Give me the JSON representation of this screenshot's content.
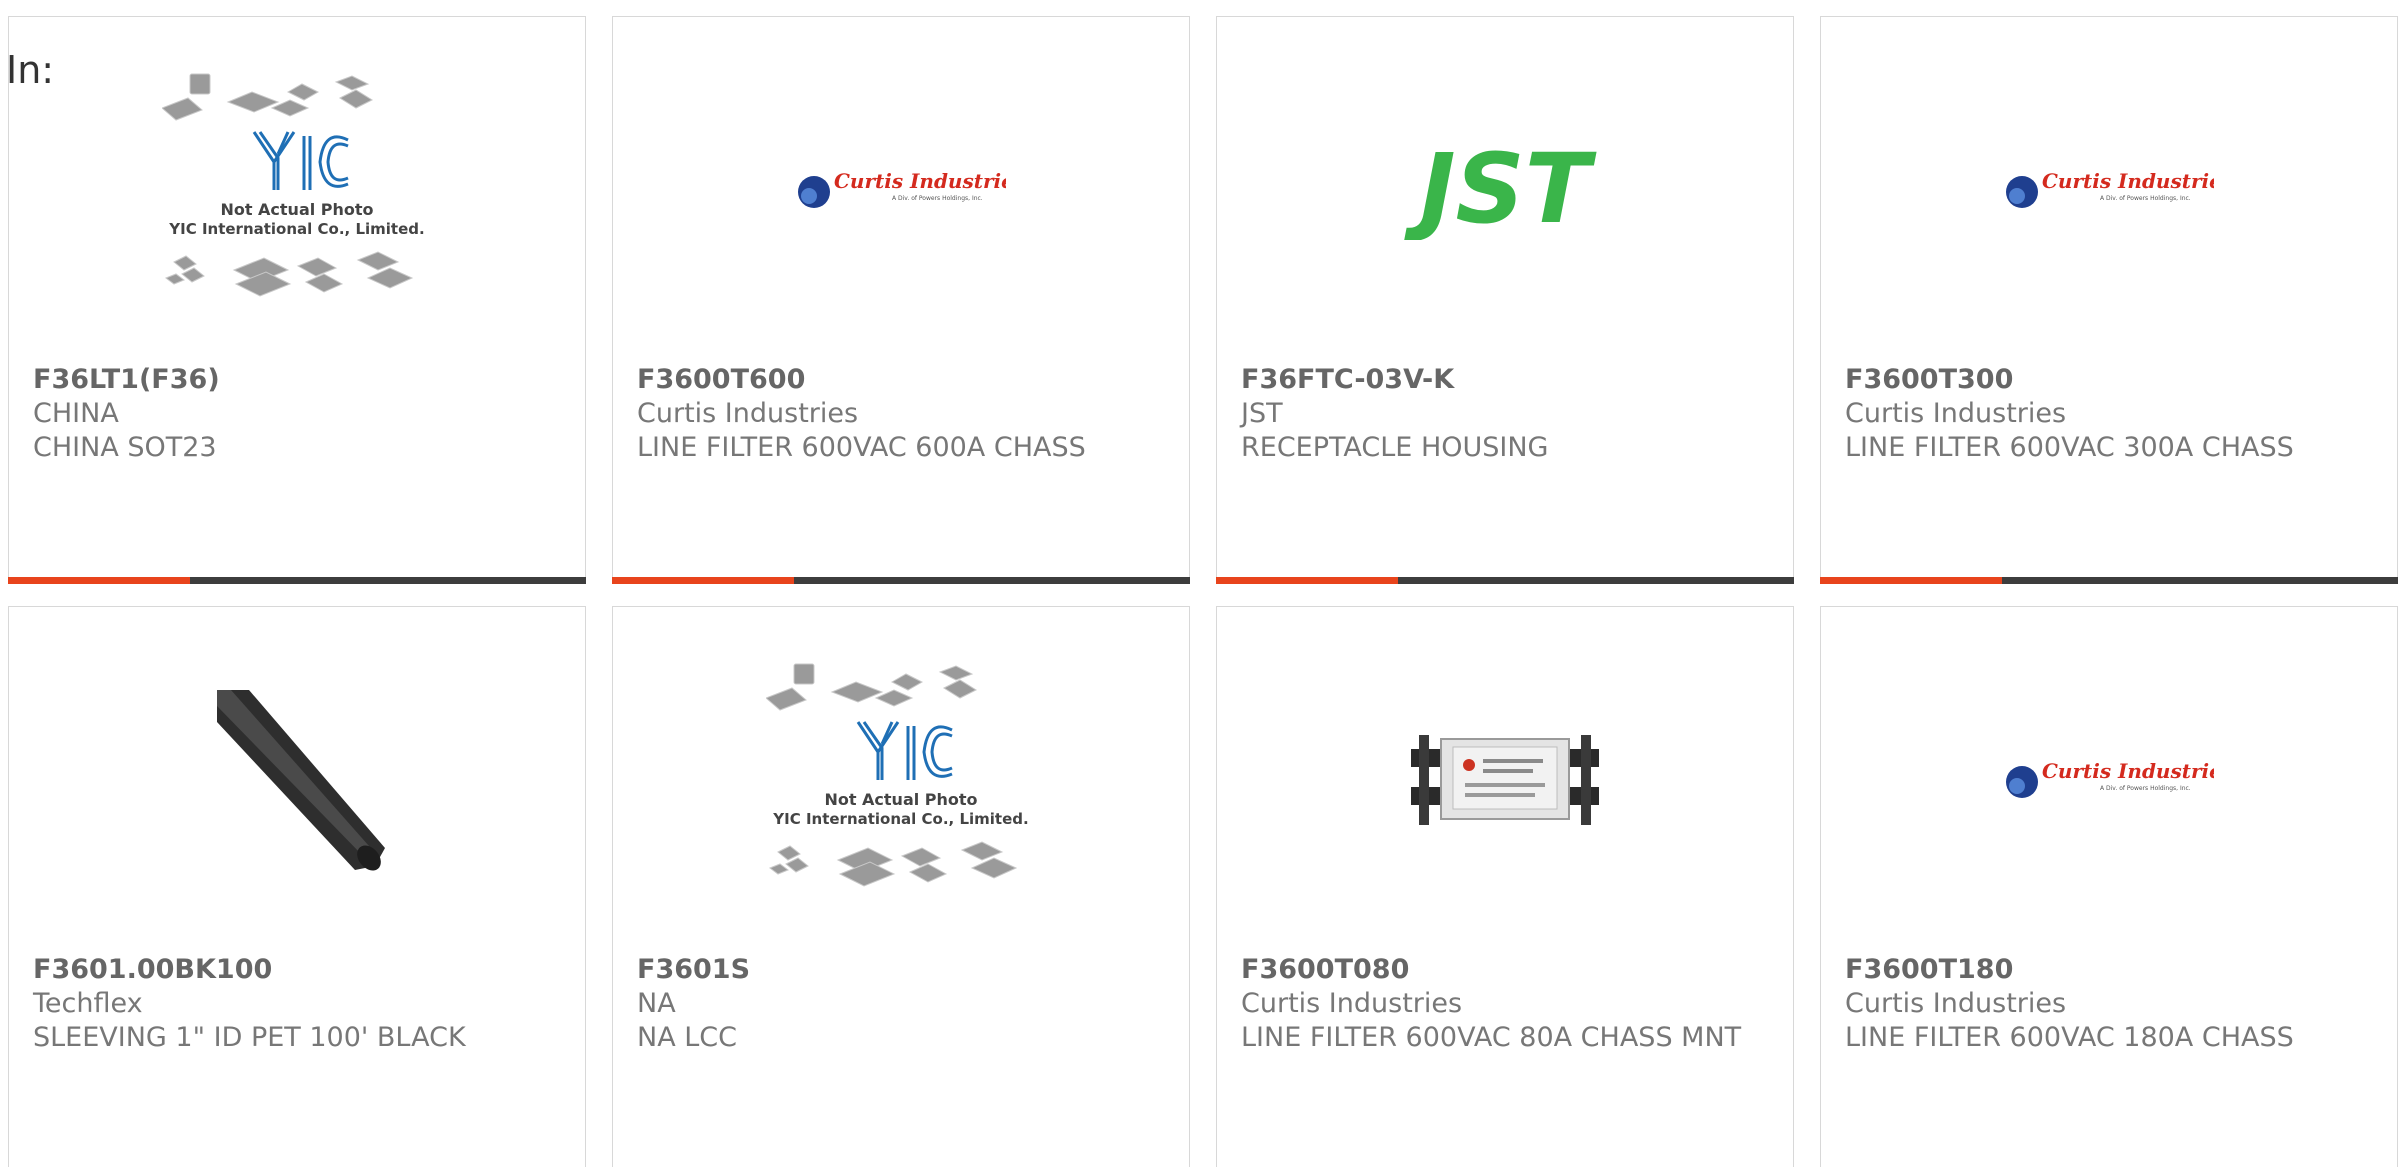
{
  "filter": {
    "in_label": "In:"
  },
  "colors": {
    "accent": "#e8441c",
    "bar": "#3d3d3d",
    "jst_green": "#3ab54a",
    "curtis_red": "#d42a1e",
    "curtis_blue": "#1f3f8f"
  },
  "products": [
    {
      "part_number": "F36LT1(F36)",
      "manufacturer": "CHINA",
      "description": "CHINA SOT23",
      "image": "yic-placeholder-image",
      "image_text_1": "Not Actual Photo",
      "image_text_2": "YIC International Co., Limited."
    },
    {
      "part_number": "F3600T600",
      "manufacturer": "Curtis Industries",
      "description": "LINE FILTER 600VAC 600A CHASS",
      "image": "curtis-industries-logo"
    },
    {
      "part_number": "F36FTC-03V-K",
      "manufacturer": "JST",
      "description": "RECEPTACLE HOUSING",
      "image": "jst-logo"
    },
    {
      "part_number": "F3600T300",
      "manufacturer": "Curtis Industries",
      "description": "LINE FILTER 600VAC 300A CHASS",
      "image": "curtis-industries-logo"
    },
    {
      "part_number": "F3601.00BK100",
      "manufacturer": "Techflex",
      "description": "SLEEVING 1\" ID PET 100' BLACK",
      "image": "black-sleeving-photo"
    },
    {
      "part_number": "F3601S",
      "manufacturer": "NA",
      "description": "NA LCC",
      "image": "yic-placeholder-image",
      "image_text_1": "Not Actual Photo",
      "image_text_2": "YIC International Co., Limited."
    },
    {
      "part_number": "F3600T080",
      "manufacturer": "Curtis Industries",
      "description": "LINE FILTER 600VAC 80A CHASS MNT",
      "image": "line-filter-photo"
    },
    {
      "part_number": "F3600T180",
      "manufacturer": "Curtis Industries",
      "description": "LINE FILTER 600VAC 180A CHASS",
      "image": "curtis-industries-logo"
    }
  ]
}
